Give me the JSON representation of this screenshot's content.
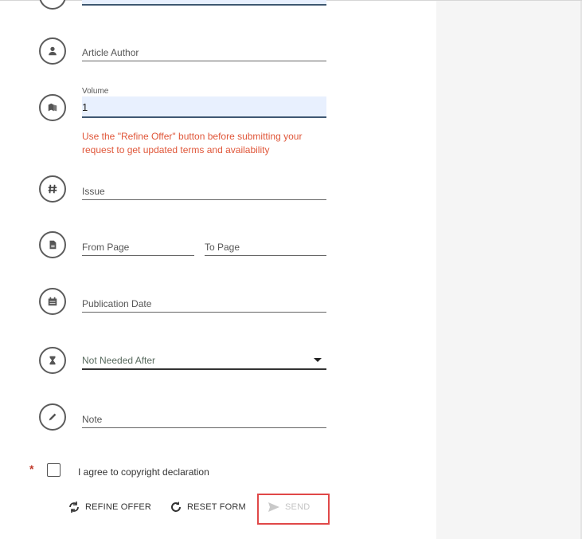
{
  "form": {
    "author": {
      "label": "Article Author"
    },
    "volume": {
      "label": "Volume",
      "value": "1"
    },
    "refine_warning": "Use the \"Refine Offer\" button before submitting your request to get updated terms and availability",
    "issue": {
      "label": "Issue"
    },
    "from_page": {
      "label": "From Page"
    },
    "to_page": {
      "label": "To Page"
    },
    "publication_date": {
      "label": "Publication Date"
    },
    "not_needed_after": {
      "label": "Not Needed After"
    },
    "note": {
      "label": "Note"
    },
    "copyright": {
      "required_marker": "*",
      "label": "I agree to copyright declaration"
    }
  },
  "actions": {
    "refine": "REFINE OFFER",
    "reset": "RESET FORM",
    "send": "SEND"
  },
  "colors": {
    "warning": "#e0573a",
    "highlight": "#e04848",
    "filled_bg": "#e8f0fe"
  }
}
